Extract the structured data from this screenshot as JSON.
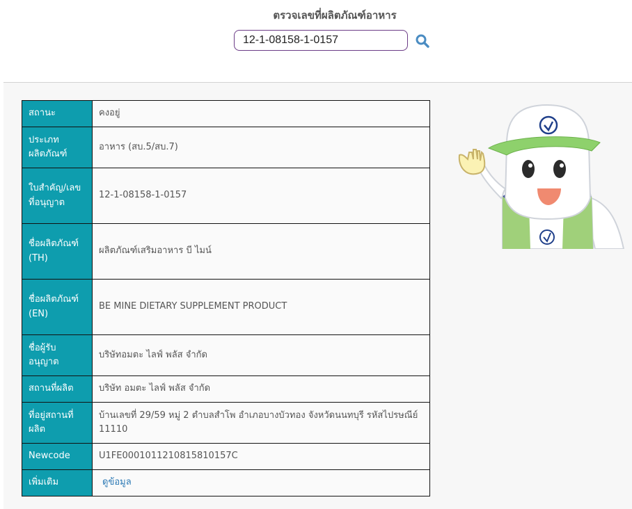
{
  "header": {
    "title": "ตรวจเลขที่ผลิตภัณฑ์อาหาร"
  },
  "search": {
    "value": "12-1-08158-1-0157",
    "icon": "search-icon"
  },
  "table": {
    "rows": [
      {
        "label": "สถานะ",
        "value": "คงอยู่"
      },
      {
        "label": "ประเภทผลิตภัณฑ์",
        "value": "อาหาร (สบ.5/สบ.7)"
      },
      {
        "label": "ใบสำคัญ/เลขที่อนุญาต",
        "value": "12-1-08158-1-0157"
      },
      {
        "label": "ชื่อผลิตภัณฑ์ (TH)",
        "value": "ผลิตภัณฑ์เสริมอาหาร บี ไมน์"
      },
      {
        "label": "ชื่อผลิตภัณฑ์ (EN)",
        "value": "BE MINE DIETARY SUPPLEMENT PRODUCT"
      },
      {
        "label": "ชื่อผู้รับอนุญาต",
        "value": "บริษัทอมตะ ไลฟ์ พลัส จำกัด"
      },
      {
        "label": "สถานที่ผลิต",
        "value": "บริษัท อมตะ ไลฟ์ พลัส จำกัด"
      },
      {
        "label": "ที่อยู่สถานที่ผลิต",
        "value": "บ้านเลขที่ 29/59 หมู่ 2 ตำบลสำโพ อำเภอบางบัวทอง จังหวัดนนทบุรี รหัสไปรษณีย์ 11110"
      },
      {
        "label": "Newcode",
        "value": "U1FE0001011210815810157C"
      },
      {
        "label": "เพิ่มเติม",
        "value": "ดูข้อมูล"
      }
    ]
  },
  "colors": {
    "label_bg": "#0e9dae",
    "link": "#2a78b4",
    "search_border": "#6b3b86",
    "mascot_cap": "#8ed16c"
  },
  "mascot": {
    "icon": "mascot-image"
  }
}
